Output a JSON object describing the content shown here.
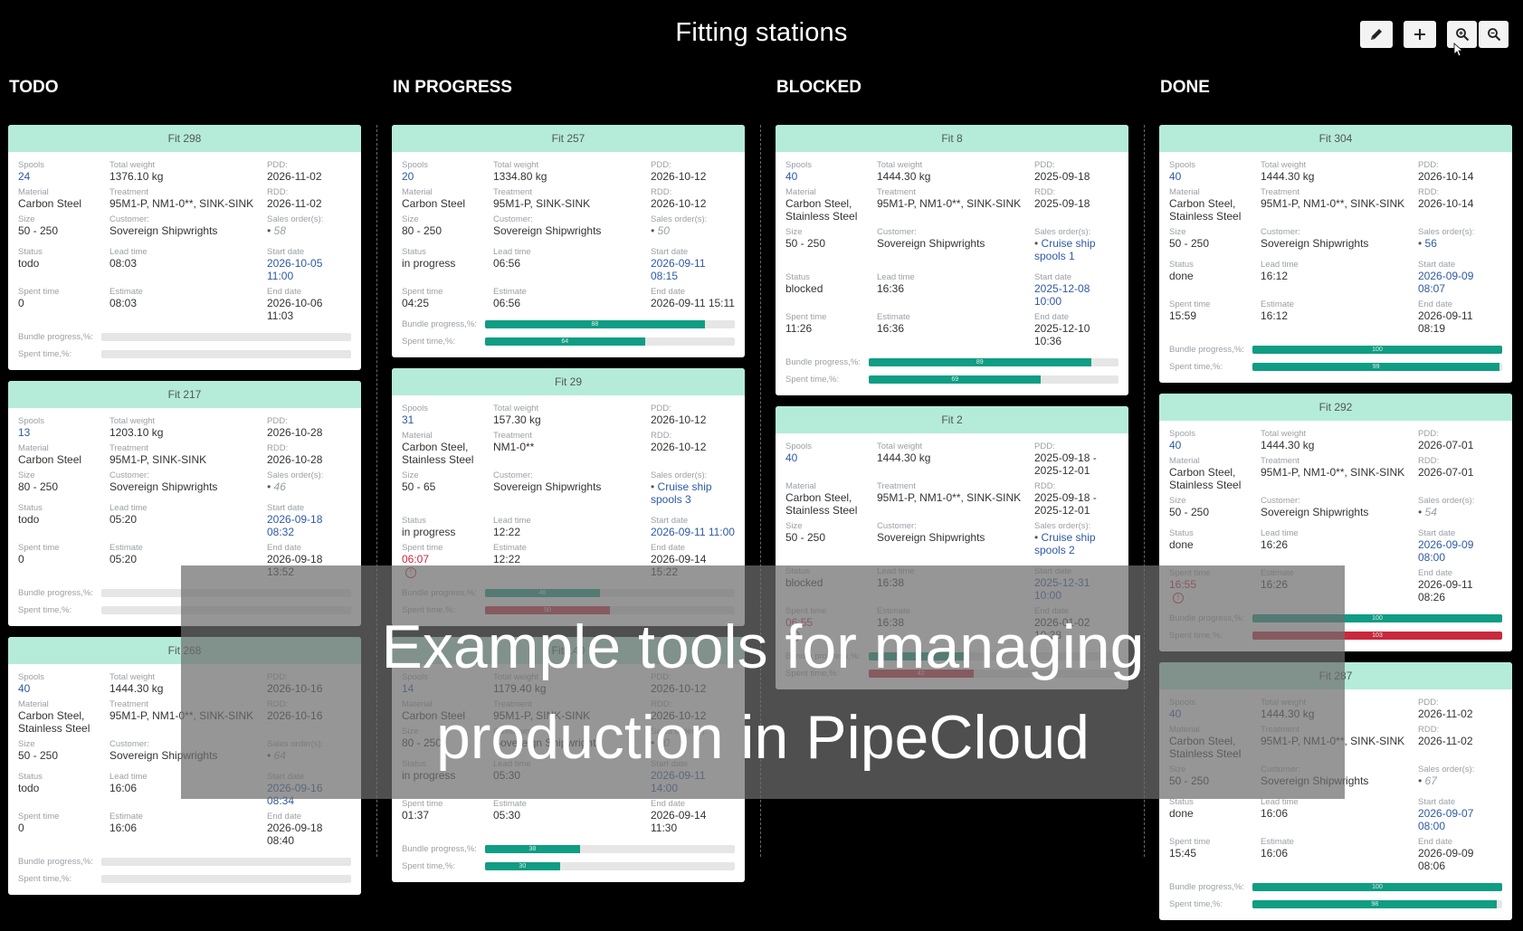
{
  "title": "Fitting stations",
  "toolbar": {
    "buttons": [
      {
        "name": "edit-button",
        "icon": "pencil-icon"
      },
      {
        "name": "add-button",
        "icon": "plus-icon"
      },
      {
        "name": "zoom-in-button",
        "icon": "zoom-in-icon"
      },
      {
        "name": "zoom-out-button",
        "icon": "zoom-out-icon"
      }
    ]
  },
  "labels": {
    "spools": "Spools",
    "total_weight": "Total weight",
    "pdd": "PDD:",
    "material": "Material",
    "treatment": "Treatment",
    "rdd": "RDD:",
    "size": "Size",
    "customer": "Customer:",
    "sales_orders": "Sales order(s):",
    "status": "Status",
    "lead_time": "Lead time",
    "start_date": "Start date",
    "spent_time": "Spent time",
    "estimate": "Estimate",
    "end_date": "End date",
    "bundle_progress": "Bundle progress,%:",
    "spent_time_pct": "Spent time,%:"
  },
  "colors": {
    "header_bg": "#b4ecd9",
    "progress_green": "#0f9d83",
    "progress_red": "#c9283d",
    "link": "#2d5aa5"
  },
  "columns": [
    {
      "title": "TODO",
      "cards": [
        {
          "name": "Fit 298",
          "spools": "24",
          "total_weight": "1376.10 kg",
          "pdd": "2026-11-02",
          "material": "Carbon Steel",
          "treatment": "95M1-P, NM1-0**, SINK-SINK",
          "rdd": "2026-11-02",
          "size": "50 - 250",
          "customer": "Sovereign Shipwrights",
          "sales_order": "58",
          "sales_order_muted": true,
          "status": "todo",
          "lead_time": "08:03",
          "start_date": "2026-10-05 11:00",
          "spent_time": "0",
          "spent_warn": false,
          "estimate": "08:03",
          "end_date": "2026-10-06 11:03",
          "bundle_progress": 0,
          "spent_pct": 0
        },
        {
          "name": "Fit 217",
          "spools": "13",
          "total_weight": "1203.10 kg",
          "pdd": "2026-10-28",
          "material": "Carbon Steel",
          "treatment": "95M1-P, SINK-SINK",
          "rdd": "2026-10-28",
          "size": "80 - 250",
          "customer": "Sovereign Shipwrights",
          "sales_order": "46",
          "sales_order_muted": true,
          "status": "todo",
          "lead_time": "05:20",
          "start_date": "2026-09-18 08:32",
          "spent_time": "0",
          "spent_warn": false,
          "estimate": "05:20",
          "end_date": "2026-09-18 13:52",
          "bundle_progress": 0,
          "spent_pct": 0
        },
        {
          "name": "Fit 268",
          "spools": "40",
          "total_weight": "1444.30 kg",
          "pdd": "2026-10-16",
          "material": "Carbon Steel, Stainless Steel",
          "treatment": "95M1-P, NM1-0**, SINK-SINK",
          "rdd": "2026-10-16",
          "size": "50 - 250",
          "customer": "Sovereign Shipwrights",
          "sales_order": "64",
          "sales_order_muted": true,
          "status": "todo",
          "lead_time": "16:06",
          "start_date": "2026-09-16 08:34",
          "spent_time": "0",
          "spent_warn": false,
          "estimate": "16:06",
          "end_date": "2026-09-18 08:40",
          "bundle_progress": 0,
          "spent_pct": 0
        }
      ]
    },
    {
      "title": "IN PROGRESS",
      "cards": [
        {
          "name": "Fit 257",
          "spools": "20",
          "total_weight": "1334.80 kg",
          "pdd": "2026-10-12",
          "material": "Carbon Steel",
          "treatment": "95M1-P, SINK-SINK",
          "rdd": "2026-10-12",
          "size": "80 - 250",
          "customer": "Sovereign Shipwrights",
          "sales_order": "50",
          "sales_order_muted": true,
          "status": "in progress",
          "lead_time": "06:56",
          "start_date": "2026-09-11 08:15",
          "spent_time": "04:25",
          "spent_warn": false,
          "estimate": "06:56",
          "end_date": "2026-09-11 15:11",
          "bundle_progress": 88,
          "spent_pct": 64
        },
        {
          "name": "Fit 29",
          "spools": "31",
          "total_weight": "157.30 kg",
          "pdd": "2026-10-12",
          "material": "Carbon Steel, Stainless Steel",
          "treatment": "NM1-0**",
          "rdd": "2026-10-12",
          "size": "50 - 65",
          "customer": "Sovereign Shipwrights",
          "sales_order": "Cruise ship spools 3",
          "sales_order_muted": false,
          "status": "in progress",
          "lead_time": "12:22",
          "start_date": "2026-09-11 11:00",
          "spent_time": "06:07",
          "spent_warn": true,
          "estimate": "12:22",
          "end_date": "2026-09-14 15:22",
          "bundle_progress": 46,
          "spent_pct": 50
        },
        {
          "name": "Fit 140",
          "spools": "14",
          "total_weight": "1179.40 kg",
          "pdd": "2026-10-12",
          "material": "Carbon Steel",
          "treatment": "95M1-P, SINK-SINK",
          "rdd": "2026-10-12",
          "size": "80 - 250",
          "customer": "Sovereign Shipwrights",
          "sales_order": "50",
          "sales_order_muted": true,
          "status": "in progress",
          "lead_time": "05:30",
          "start_date": "2026-09-11 14:00",
          "spent_time": "01:37",
          "spent_warn": false,
          "estimate": "05:30",
          "end_date": "2026-09-14 11:30",
          "bundle_progress": 38,
          "spent_pct": 30
        }
      ]
    },
    {
      "title": "BLOCKED",
      "cards": [
        {
          "name": "Fit 8",
          "spools": "40",
          "total_weight": "1444.30 kg",
          "pdd": "2025-09-18",
          "material": "Carbon Steel, Stainless Steel",
          "treatment": "95M1-P, NM1-0**, SINK-SINK",
          "rdd": "2025-09-18",
          "size": "50 - 250",
          "customer": "Sovereign Shipwrights",
          "sales_order": "Cruise ship spools 1",
          "sales_order_muted": false,
          "status": "blocked",
          "lead_time": "16:36",
          "start_date": "2025-12-08 10:00",
          "spent_time": "11:26",
          "spent_warn": false,
          "estimate": "16:36",
          "end_date": "2025-12-10 10:36",
          "bundle_progress": 89,
          "spent_pct": 69
        },
        {
          "name": "Fit 2",
          "spools": "40",
          "total_weight": "1444.30 kg",
          "pdd": "2025-09-18 - 2025-12-01",
          "material": "Carbon Steel, Stainless Steel",
          "treatment": "95M1-P, NM1-0**, SINK-SINK",
          "rdd": "2025-09-18 - 2025-12-01",
          "size": "50 - 250",
          "customer": "Sovereign Shipwrights",
          "sales_order": "Cruise ship spools 2",
          "sales_order_muted": false,
          "status": "blocked",
          "lead_time": "16:38",
          "start_date": "2025-12-31 10:00",
          "spent_time": "06:55",
          "spent_warn": true,
          "estimate": "16:38",
          "end_date": "2026-01-02 10:38",
          "bundle_progress": 39,
          "spent_pct": 42
        }
      ]
    },
    {
      "title": "DONE",
      "cards": [
        {
          "name": "Fit 304",
          "spools": "40",
          "total_weight": "1444.30 kg",
          "pdd": "2026-10-14",
          "material": "Carbon Steel, Stainless Steel",
          "treatment": "95M1-P, NM1-0**, SINK-SINK",
          "rdd": "2026-10-14",
          "size": "50 - 250",
          "customer": "Sovereign Shipwrights",
          "sales_order": "56",
          "sales_order_muted": false,
          "status": "done",
          "lead_time": "16:12",
          "start_date": "2026-09-09 08:07",
          "spent_time": "15:59",
          "spent_warn": false,
          "estimate": "16:12",
          "end_date": "2026-09-11 08:19",
          "bundle_progress": 100,
          "spent_pct": 99
        },
        {
          "name": "Fit 292",
          "spools": "40",
          "total_weight": "1444.30 kg",
          "pdd": "2026-07-01",
          "material": "Carbon Steel, Stainless Steel",
          "treatment": "95M1-P, NM1-0**, SINK-SINK",
          "rdd": "2026-07-01",
          "size": "50 - 250",
          "customer": "Sovereign Shipwrights",
          "sales_order": "54",
          "sales_order_muted": true,
          "status": "done",
          "lead_time": "16:26",
          "start_date": "2026-09-09 08:00",
          "spent_time": "16:55",
          "spent_warn": true,
          "estimate": "16:26",
          "end_date": "2026-09-11 08:26",
          "bundle_progress": 100,
          "spent_pct": 103
        },
        {
          "name": "Fit 287",
          "spools": "40",
          "total_weight": "1444.30 kg",
          "pdd": "2026-11-02",
          "material": "Carbon Steel, Stainless Steel",
          "treatment": "95M1-P, NM1-0**, SINK-SINK",
          "rdd": "2026-11-02",
          "size": "50 - 250",
          "customer": "Sovereign Shipwrights",
          "sales_order": "67",
          "sales_order_muted": true,
          "status": "done",
          "lead_time": "16:06",
          "start_date": "2026-09-07 08:00",
          "spent_time": "15:45",
          "spent_warn": false,
          "estimate": "16:06",
          "end_date": "2026-09-09 08:06",
          "bundle_progress": 100,
          "spent_pct": 98
        }
      ]
    }
  ],
  "overlay": {
    "line1": "Example tools for managing",
    "line2": "production in PipeCloud"
  }
}
